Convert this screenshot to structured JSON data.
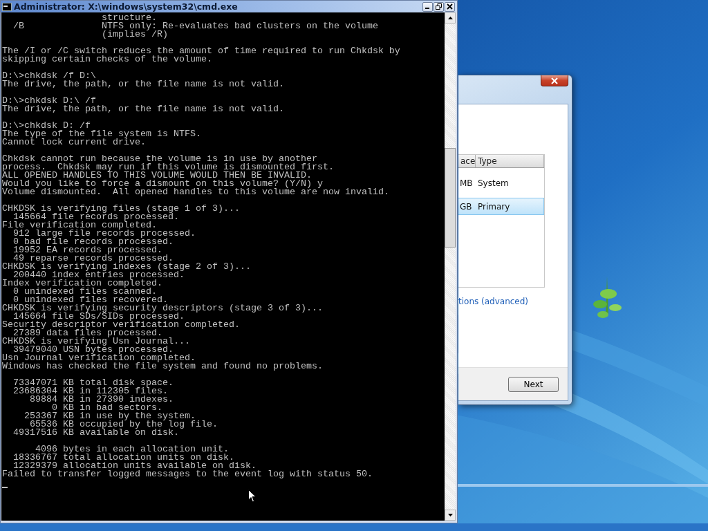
{
  "console_window": {
    "title": "Administrator: X:\\windows\\system32\\cmd.exe",
    "blocks": [
      [
        "                  structure.",
        "  /B              NTFS only: Re-evaluates bad clusters on the volume",
        "                  (implies /R)"
      ],
      [
        "The /I or /C switch reduces the amount of time required to run Chkdsk by",
        "skipping certain checks of the volume."
      ],
      [
        "D:\\>chkdsk /f D:\\",
        "The drive, the path, or the file name is not valid."
      ],
      [
        "D:\\>chkdsk D:\\ /f",
        "The drive, the path, or the file name is not valid."
      ],
      [
        "D:\\>chkdsk D: /f",
        "The type of the file system is NTFS.",
        "Cannot lock current drive."
      ],
      [
        "Chkdsk cannot run because the volume is in use by another",
        "process.  Chkdsk may run if this volume is dismounted first.",
        "ALL OPENED HANDLES TO THIS VOLUME WOULD THEN BE INVALID.",
        "Would you like to force a dismount on this volume? (Y/N) y",
        "Volume dismounted.  All opened handles to this volume are now invalid."
      ],
      [
        "CHKDSK is verifying files (stage 1 of 3)...",
        "  145664 file records processed.",
        "File verification completed.",
        "  912 large file records processed.",
        "  0 bad file records processed.",
        "  19952 EA records processed.",
        "  49 reparse records processed.",
        "CHKDSK is verifying indexes (stage 2 of 3)...",
        "  200440 index entries processed.",
        "Index verification completed.",
        "  0 unindexed files scanned.",
        "  0 unindexed files recovered.",
        "CHKDSK is verifying security descriptors (stage 3 of 3)...",
        "  145664 file SDs/SIDs processed.",
        "Security descriptor verification completed.",
        "  27389 data files processed.",
        "CHKDSK is verifying Usn Journal...",
        "  39479040 USN bytes processed.",
        "Usn Journal verification completed.",
        "Windows has checked the file system and found no problems."
      ],
      [
        "  73347071 KB total disk space.",
        "  23686304 KB in 112305 files.",
        "     89884 KB in 27390 indexes.",
        "         0 KB in bad sectors.",
        "    253367 KB in use by the system.",
        "     65536 KB occupied by the log file.",
        "  49317516 KB available on disk."
      ],
      [
        "      4096 bytes in each allocation unit.",
        "  18336767 total allocation units on disk.",
        "  12329379 allocation units available on disk.",
        "Failed to transfer logged messages to the event log with status 50."
      ]
    ]
  },
  "setup_window": {
    "list": {
      "columns": [
        "ace",
        "Type"
      ],
      "rows": [
        {
          "cells": [
            "MB",
            "System"
          ],
          "selected": false
        },
        {
          "cells": [
            "GB",
            "Primary"
          ],
          "selected": true
        }
      ]
    },
    "link": "tions (advanced)",
    "buttons": [
      "Next"
    ]
  }
}
